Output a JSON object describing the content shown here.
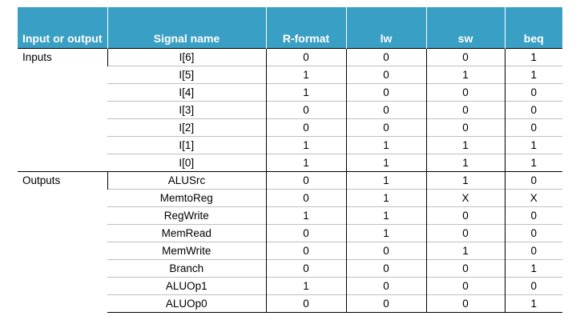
{
  "headers": [
    "Input or output",
    "Signal name",
    "R-format",
    "lw",
    "sw",
    "beq"
  ],
  "groups": {
    "inputs": "Inputs",
    "outputs": "Outputs"
  },
  "rows": [
    {
      "signal": "I[6]",
      "values": [
        "0",
        "0",
        "0",
        "1"
      ]
    },
    {
      "signal": "I[5]",
      "values": [
        "1",
        "0",
        "1",
        "1"
      ]
    },
    {
      "signal": "I[4]",
      "values": [
        "1",
        "0",
        "0",
        "0"
      ]
    },
    {
      "signal": "I[3]",
      "values": [
        "0",
        "0",
        "0",
        "0"
      ]
    },
    {
      "signal": "I[2]",
      "values": [
        "0",
        "0",
        "0",
        "0"
      ]
    },
    {
      "signal": "I[1]",
      "values": [
        "1",
        "1",
        "1",
        "1"
      ]
    },
    {
      "signal": "I[0]",
      "values": [
        "1",
        "1",
        "1",
        "1"
      ]
    },
    {
      "signal": "ALUSrc",
      "values": [
        "0",
        "1",
        "1",
        "0"
      ]
    },
    {
      "signal": "MemtoReg",
      "values": [
        "0",
        "1",
        "X",
        "X"
      ]
    },
    {
      "signal": "RegWrite",
      "values": [
        "1",
        "1",
        "0",
        "0"
      ]
    },
    {
      "signal": "MemRead",
      "values": [
        "0",
        "1",
        "0",
        "0"
      ]
    },
    {
      "signal": "MemWrite",
      "values": [
        "0",
        "0",
        "1",
        "0"
      ]
    },
    {
      "signal": "Branch",
      "values": [
        "0",
        "0",
        "0",
        "1"
      ]
    },
    {
      "signal": "ALUOp1",
      "values": [
        "1",
        "0",
        "0",
        "0"
      ]
    },
    {
      "signal": "ALUOp0",
      "values": [
        "0",
        "0",
        "0",
        "1"
      ]
    }
  ]
}
